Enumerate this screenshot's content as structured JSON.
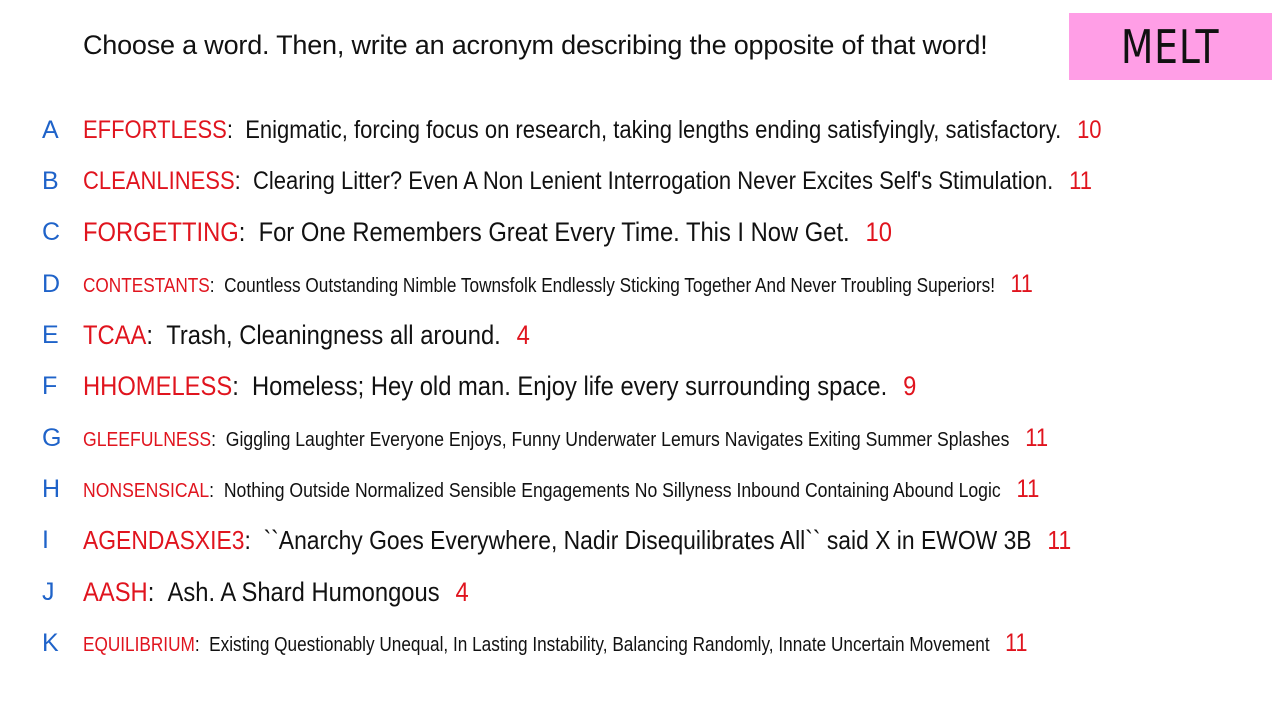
{
  "header": {
    "instruction": "Choose a word. Then, write an acronym describing the opposite of that word!",
    "badge": "MELT"
  },
  "entries": [
    {
      "letter": "A",
      "word": "EFFORTLESS",
      "acronym": "Enigmatic, forcing focus on research, taking lengths ending satisfyingly, satisfactory.",
      "score": "10"
    },
    {
      "letter": "B",
      "word": "CLEANLINESS",
      "acronym": "Clearing Litter? Even A Non Lenient Interrogation Never Excites Self's Stimulation.",
      "score": "11"
    },
    {
      "letter": "C",
      "word": "FORGETTING",
      "acronym": "For One Remembers Great Every Time. This I Now Get.",
      "score": "10"
    },
    {
      "letter": "D",
      "word": "CONTESTANTS",
      "acronym": "Countless Outstanding Nimble Townsfolk Endlessly Sticking Together And Never Troubling Superiors!",
      "score": "11"
    },
    {
      "letter": "E",
      "word": "TCAA",
      "acronym": "Trash, Cleaningness all around.",
      "score": "4"
    },
    {
      "letter": "F",
      "word": "HHOMELESS",
      "acronym": "Homeless; Hey old man. Enjoy life every surrounding space.",
      "score": "9"
    },
    {
      "letter": "G",
      "word": "GLEEFULNESS",
      "acronym": "Giggling Laughter Everyone Enjoys, Funny Underwater Lemurs Navigates Exiting Summer Splashes",
      "score": "11"
    },
    {
      "letter": "H",
      "word": "NONSENSICAL",
      "acronym": "Nothing Outside Normalized Sensible Engagements No Sillyness Inbound Containing Abound Logic",
      "score": "11"
    },
    {
      "letter": "I",
      "word": "AGENDASXIE3",
      "acronym": "``Anarchy Goes Everywhere, Nadir Disequilibrates All`` said X in EWOW 3B",
      "score": "11"
    },
    {
      "letter": "J",
      "word": "AASH",
      "acronym": "Ash. A Shard Humongous",
      "score": "4"
    },
    {
      "letter": "K",
      "word": "EQUILIBRIUM",
      "acronym": "Existing Questionably Unequal, In Lasting Instability, Balancing Randomly, Innate Uncertain Movement",
      "score": "11"
    }
  ],
  "colors": {
    "word": "#e0141e",
    "letter": "#1f63c9",
    "badge_bg": "#ff9ee6",
    "text": "#111111"
  }
}
